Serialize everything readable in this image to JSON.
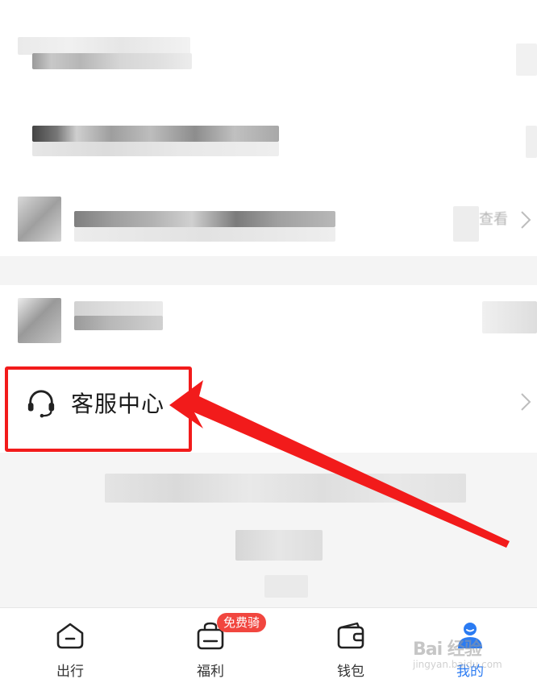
{
  "menu": {
    "row3_trailing_text": "查看",
    "customer_service_label": "客服中心"
  },
  "tabbar": {
    "tabs": [
      {
        "label": "出行",
        "icon": "house-icon",
        "active": false
      },
      {
        "label": "福利",
        "icon": "gift-bag-icon",
        "active": false,
        "badge": "免费骑"
      },
      {
        "label": "钱包",
        "icon": "wallet-icon",
        "active": false
      },
      {
        "label": "我的",
        "icon": "user-icon",
        "active": true
      }
    ]
  },
  "watermark": {
    "line1": "Bai 经验",
    "line2": "jingyan.baidu.com"
  },
  "colors": {
    "highlight_red": "#f21b1b",
    "active_tab_blue": "#2b7bf2",
    "badge_red": "#f1463f"
  }
}
